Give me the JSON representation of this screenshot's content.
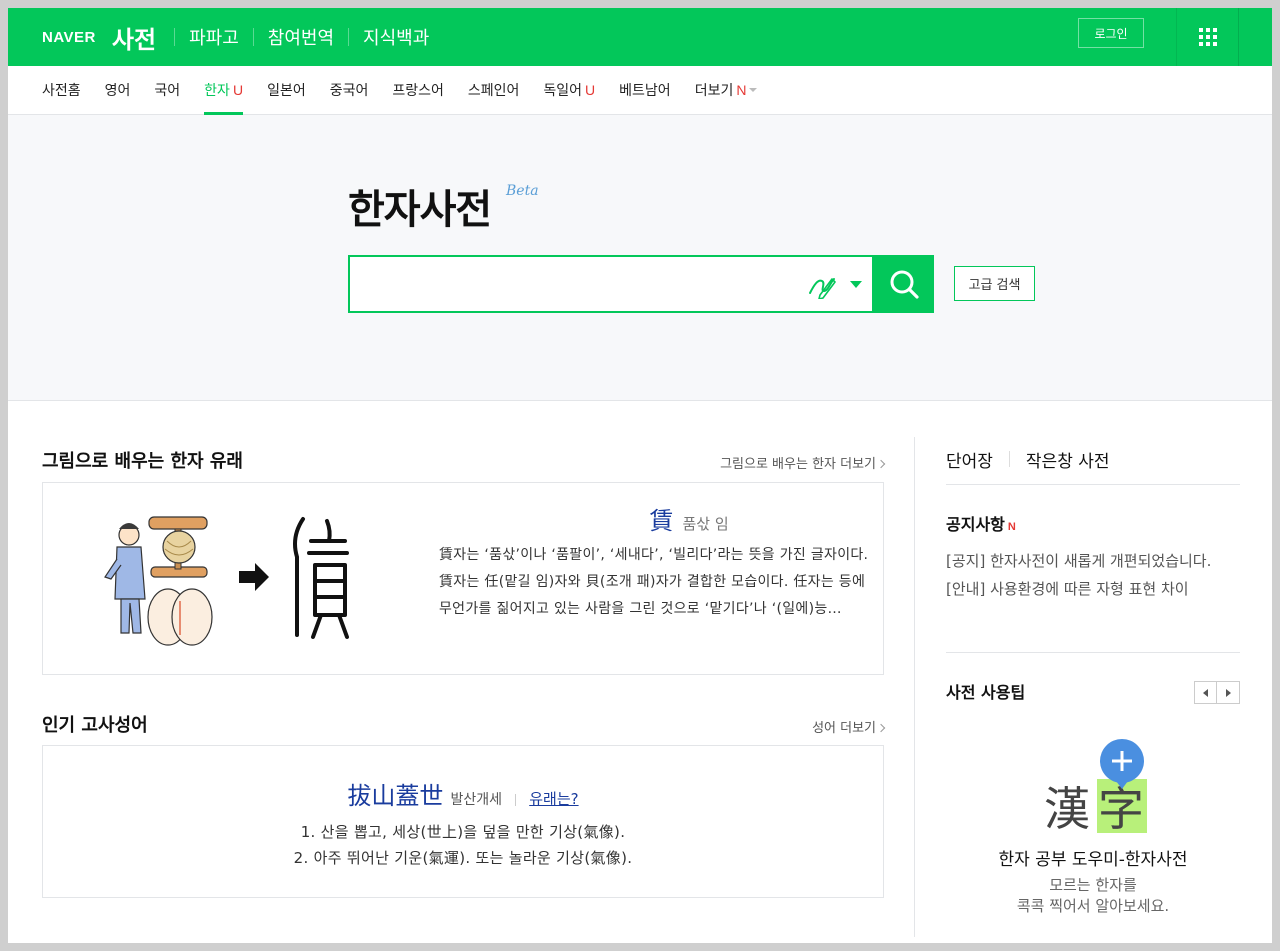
{
  "header": {
    "logo": "NAVER",
    "service": "사전",
    "links": [
      "파파고",
      "참여번역",
      "지식백과"
    ],
    "login": "로그인"
  },
  "tabs": [
    {
      "label": "사전홈",
      "badge": ""
    },
    {
      "label": "영어",
      "badge": ""
    },
    {
      "label": "국어",
      "badge": ""
    },
    {
      "label": "한자",
      "badge": "U",
      "active": true
    },
    {
      "label": "일본어",
      "badge": ""
    },
    {
      "label": "중국어",
      "badge": ""
    },
    {
      "label": "프랑스어",
      "badge": ""
    },
    {
      "label": "스페인어",
      "badge": ""
    },
    {
      "label": "독일어",
      "badge": "U"
    },
    {
      "label": "베트남어",
      "badge": ""
    },
    {
      "label": "더보기",
      "badge": "N"
    }
  ],
  "search": {
    "title": "한자사전",
    "beta": "Beta",
    "input_value": "",
    "advanced": "고급 검색"
  },
  "origin": {
    "section_title": "그림으로 배우는 한자 유래",
    "more": "그림으로 배우는 한자 더보기",
    "hanja": "賃",
    "reading": "품삯 임",
    "description": "賃자는 ‘품삯’이나 ‘품팔이’, ‘세내다’, ‘빌리다’라는 뜻을 가진 글자이다. 賃자는 任(맡길 임)자와 貝(조개 패)자가 결합한 모습이다. 任자는 등에 무언가를 짊어지고 있는 사람을 그린 것으로 ‘맡기다’나 ‘(일에)능…"
  },
  "idiom": {
    "section_title": "인기 고사성어",
    "more": "성어 더보기",
    "hanja": "拔山蓋世",
    "reading": "발산개세",
    "origin_link": "유래는?",
    "meanings": [
      "1. 산을 뽑고, 세상(世上)을 덮을 만한 기상(氣像).",
      "2. 아주 뛰어난 기운(氣運). 또는 놀라운 기상(氣像)."
    ]
  },
  "right": {
    "tabs": [
      "단어장",
      "작은창 사전"
    ],
    "notice_title": "공지사항",
    "notice_badge": "N",
    "notices": [
      "[공지] 한자사전이 새롭게 개편되었습니다.",
      "[안내] 사용환경에 따른 자형 표현 차이"
    ],
    "tips_title": "사전 사용팁",
    "tips_graphic_text": [
      "漢",
      "字"
    ],
    "tips_caption": "한자 공부 도우미-한자사전",
    "tips_sub": [
      "모르는 한자를",
      "콕콕 찍어서 알아보세요."
    ]
  },
  "colors": {
    "brand": "#03c75a",
    "link": "#1a3c9e",
    "badge": "#e53935"
  },
  "icons": {
    "handwrite": "pen-input-icon",
    "search": "search-icon",
    "menu": "grid-menu-icon"
  }
}
